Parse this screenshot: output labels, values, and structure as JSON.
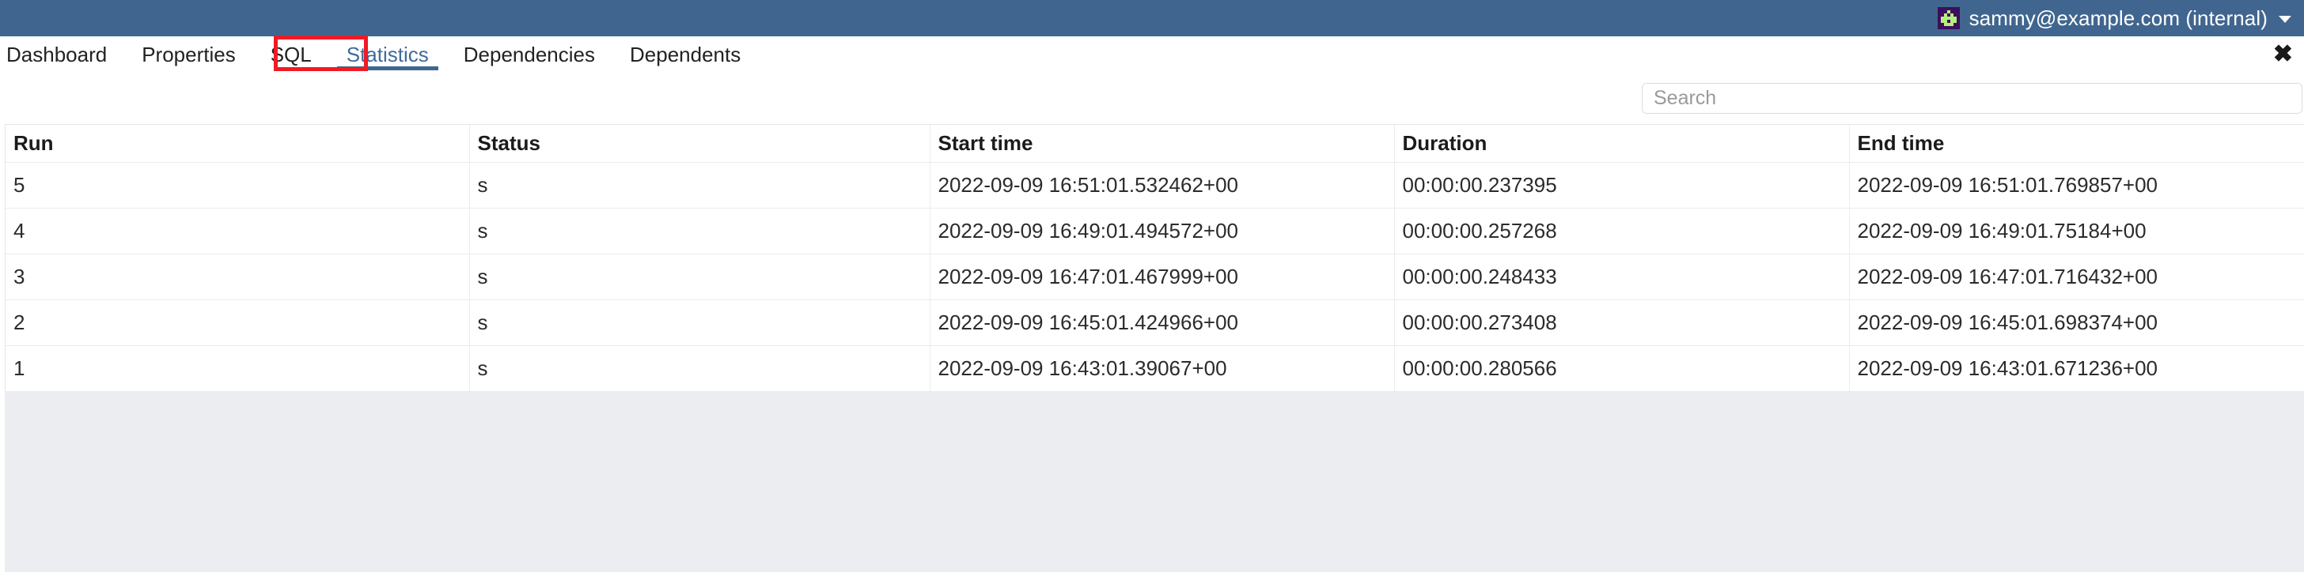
{
  "topbar": {
    "background_color": "#40668f",
    "user": {
      "avatar_icon": "identicon-avatar",
      "avatar_bg": "#3c0f5c",
      "avatar_fg": "#b4ef7e",
      "email": "sammy@example.com (internal)",
      "caret_icon": "chevron-down-icon"
    }
  },
  "tabs": {
    "items": [
      {
        "label": "Dashboard",
        "active": false
      },
      {
        "label": "Properties",
        "active": false
      },
      {
        "label": "SQL",
        "active": false
      },
      {
        "label": "Statistics",
        "active": true
      },
      {
        "label": "Dependencies",
        "active": false
      },
      {
        "label": "Dependents",
        "active": false
      }
    ],
    "close_label": "✖",
    "active_indicator_color": "#40668f",
    "active_label_color": "#3f6b9b",
    "annotation_color": "#ef1b24"
  },
  "search": {
    "placeholder": "Search",
    "value": ""
  },
  "table": {
    "columns": [
      "Run",
      "Status",
      "Start time",
      "Duration",
      "End time"
    ],
    "rows": [
      {
        "run": "5",
        "status": "s",
        "start_time": "2022-09-09 16:51:01.532462+00",
        "duration": "00:00:00.237395",
        "end_time": "2022-09-09 16:51:01.769857+00"
      },
      {
        "run": "4",
        "status": "s",
        "start_time": "2022-09-09 16:49:01.494572+00",
        "duration": "00:00:00.257268",
        "end_time": "2022-09-09 16:49:01.75184+00"
      },
      {
        "run": "3",
        "status": "s",
        "start_time": "2022-09-09 16:47:01.467999+00",
        "duration": "00:00:00.248433",
        "end_time": "2022-09-09 16:47:01.716432+00"
      },
      {
        "run": "2",
        "status": "s",
        "start_time": "2022-09-09 16:45:01.424966+00",
        "duration": "00:00:00.273408",
        "end_time": "2022-09-09 16:45:01.698374+00"
      },
      {
        "run": "1",
        "status": "s",
        "start_time": "2022-09-09 16:43:01.39067+00",
        "duration": "00:00:00.280566",
        "end_time": "2022-09-09 16:43:01.671236+00"
      }
    ]
  }
}
